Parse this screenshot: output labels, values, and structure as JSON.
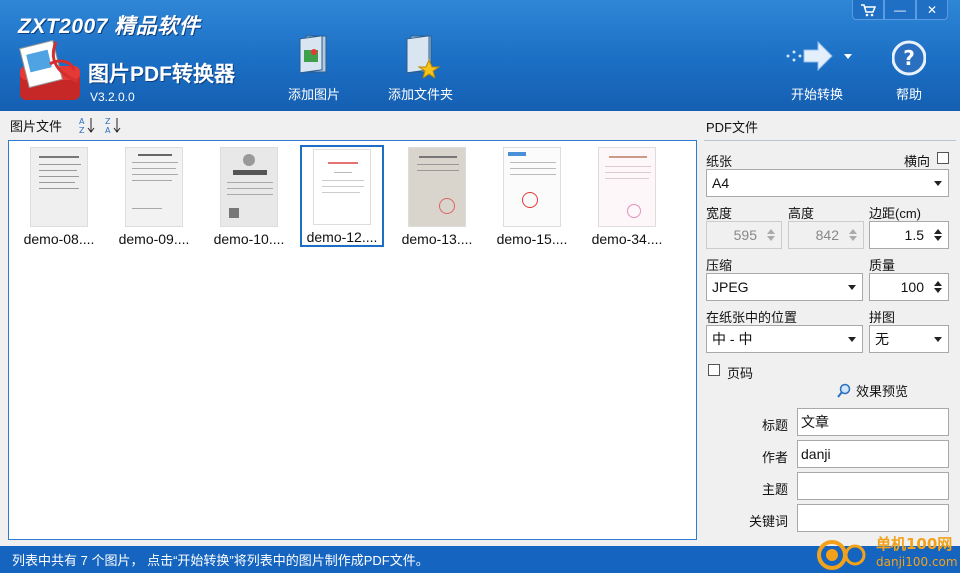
{
  "header": {
    "brand_top": "ZXT2007 精品软件",
    "app_name": "图片PDF转换器",
    "version": "V3.2.0.0",
    "buttons": {
      "add_image": "添加图片",
      "add_folder": "添加文件夹",
      "start": "开始转换",
      "help": "帮助"
    },
    "window_controls": [
      "cart-icon",
      "minimize-icon",
      "close-icon"
    ]
  },
  "left": {
    "section_label": "图片文件",
    "files": [
      {
        "label": "demo-08...."
      },
      {
        "label": "demo-09...."
      },
      {
        "label": "demo-10...."
      },
      {
        "label": "demo-12....",
        "selected": true
      },
      {
        "label": "demo-13...."
      },
      {
        "label": "demo-15...."
      },
      {
        "label": "demo-34...."
      }
    ]
  },
  "right": {
    "title": "PDF文件",
    "paper_label": "纸张",
    "landscape_label": "横向",
    "paper_value": "A4",
    "width_label": "宽度",
    "width_value": "595",
    "height_label": "高度",
    "height_value": "842",
    "margin_label": "边距(cm)",
    "margin_value": "1.5",
    "compress_label": "压缩",
    "compress_value": "JPEG",
    "quality_label": "质量",
    "quality_value": "100",
    "position_label": "在纸张中的位置",
    "position_value": "中 - 中",
    "collage_label": "拼图",
    "collage_value": "无",
    "page_number_label": "页码",
    "preview_label": "效果预览",
    "meta": {
      "title_label": "标题",
      "title_value": "文章",
      "author_label": "作者",
      "author_value": "danji",
      "subject_label": "主题",
      "subject_value": "",
      "keywords_label": "关键词",
      "keywords_value": ""
    }
  },
  "status": {
    "text": "列表中共有 7 个图片， 点击“开始转换”将列表中的图片制作成PDF文件。"
  },
  "watermark": {
    "line1": "单机100网",
    "line2": "danji100.com"
  },
  "colors": {
    "header_blue": "#1b6fc4",
    "status_blue": "#1565c0",
    "selection_blue": "#1b6fc4"
  }
}
